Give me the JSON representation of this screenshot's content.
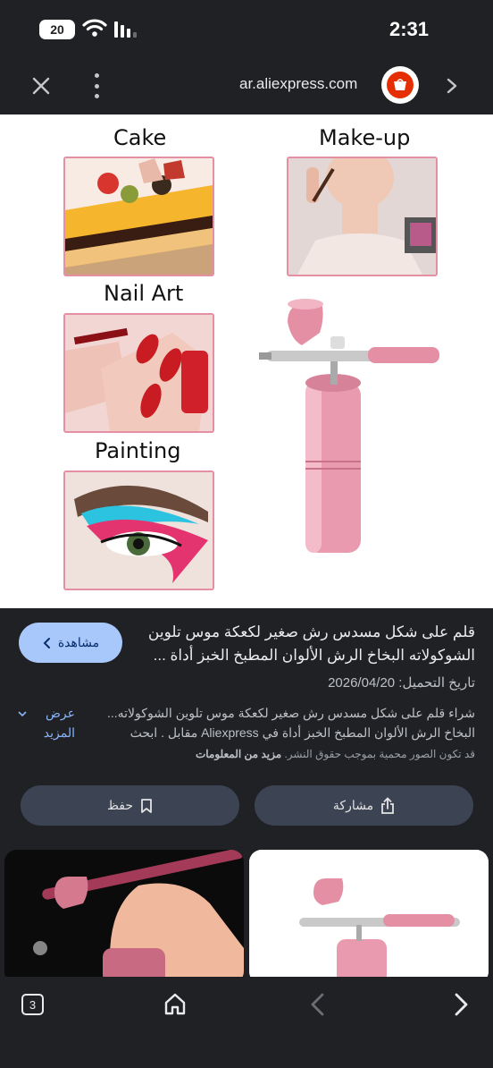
{
  "status_bar": {
    "time": "2:31",
    "battery": "20"
  },
  "url_bar": {
    "domain": "ar.aliexpress.com",
    "favicon_label": "AliExpress"
  },
  "product_image": {
    "labels": {
      "cake": "Cake",
      "makeup": "Make-up",
      "nail_art": "Nail Art",
      "painting": "Painting"
    }
  },
  "details": {
    "title": "قلم على شكل مسدس رش صغير لكعكة موس تلوين الشوكولاته البخاخ الرش الألوان المطبخ الخبز أداة ...",
    "view_button": "مشاهدة",
    "upload_date": "تاريخ التحميل: 2026/04/20",
    "description": "شراء قلم على شكل مسدس رش صغير لكعكة موس تلوين الشوكولاته... البخاخ الرش الألوان المطبخ الخبز أداة في Aliexpress مقابل . ابحث",
    "show_more": "عرض المزيد",
    "copyright_text": "قد تكون الصور محمية بموجب حقوق النشر.",
    "learn_more": "مزيد من المعلومات",
    "share_button": "مشاركة",
    "save_button": "حفظ"
  },
  "bottom_nav": {
    "tab_count": "3"
  },
  "colors": {
    "background": "#202124",
    "accent": "#a8c7fa",
    "action_button": "#3c4454",
    "link": "#8ab4f8",
    "aliexpress_red": "#e62e04",
    "pink_border": "#e58fa4"
  }
}
